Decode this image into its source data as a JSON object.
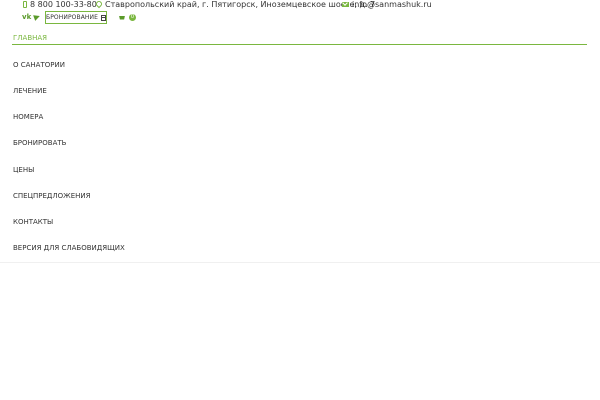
{
  "contacts": {
    "phone": "8 800 100-33-80",
    "address": "Ставропольский край, г. Пятигорск, Иноземцевское шоссе, д. 7",
    "email": "info@sanmashuk.ru",
    "phone_icon": "phone-icon",
    "address_icon": "map-pin-icon",
    "email_icon": "envelope-icon"
  },
  "social": {
    "vk_label": "vk",
    "telegram_icon": "telegram-icon"
  },
  "booking": {
    "label": "БРОНИРОВАНИЕ",
    "icon": "calendar-icon"
  },
  "cart": {
    "icon": "shopping-cart-icon",
    "count": "0"
  },
  "menu": {
    "items": [
      {
        "label": "ГЛАВНАЯ",
        "active": true
      },
      {
        "label": "О САНАТОРИИ"
      },
      {
        "label": "ЛЕЧЕНИЕ"
      },
      {
        "label": "НОМЕРА"
      },
      {
        "label": "БРОНИРОВАТЬ"
      },
      {
        "label": "ЦЕНЫ"
      },
      {
        "label": "СПЕЦПРЕДЛОЖЕНИЯ"
      },
      {
        "label": "КОНТАКТЫ"
      },
      {
        "label": "ВЕРСИЯ ДЛЯ СЛАБОВИДЯЩИХ"
      }
    ]
  },
  "colors": {
    "accent": "#7ab73f",
    "text": "#333333"
  }
}
